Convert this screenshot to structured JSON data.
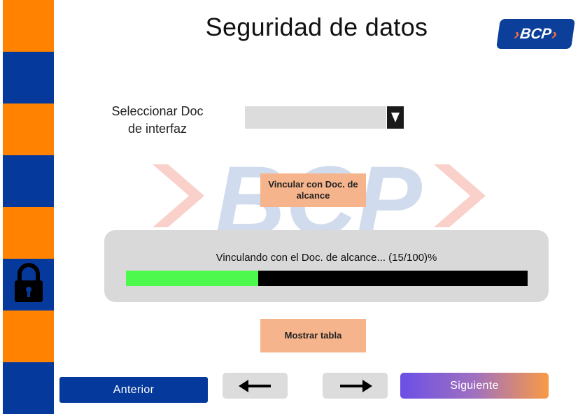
{
  "header": {
    "title": "Seguridad de datos",
    "logo_text": "BCP",
    "logo_chevron_left": "›",
    "logo_chevron_right": "›"
  },
  "sidebar": {
    "icon": "lock-icon",
    "colors": [
      "#ff8200",
      "#053a9c"
    ]
  },
  "watermark": {
    "text": "BCP"
  },
  "form": {
    "select_label_line1": "Seleccionar Doc",
    "select_label_line2": "de interfaz",
    "select_value": "",
    "select_icon": "triangle-down-icon"
  },
  "buttons": {
    "link_scope": "Vincular con Doc. de alcance",
    "show_table": "Mostrar tabla",
    "previous": "Anterior",
    "back_icon": "arrow-left-icon",
    "forward_icon": "arrow-right-icon",
    "next": "Siguiente"
  },
  "progress": {
    "text": "Vinculando con el  Doc. de alcance... (15/100)%",
    "fraction": 0.33,
    "fill_color": "#4cf94c",
    "track_color": "#000000"
  }
}
